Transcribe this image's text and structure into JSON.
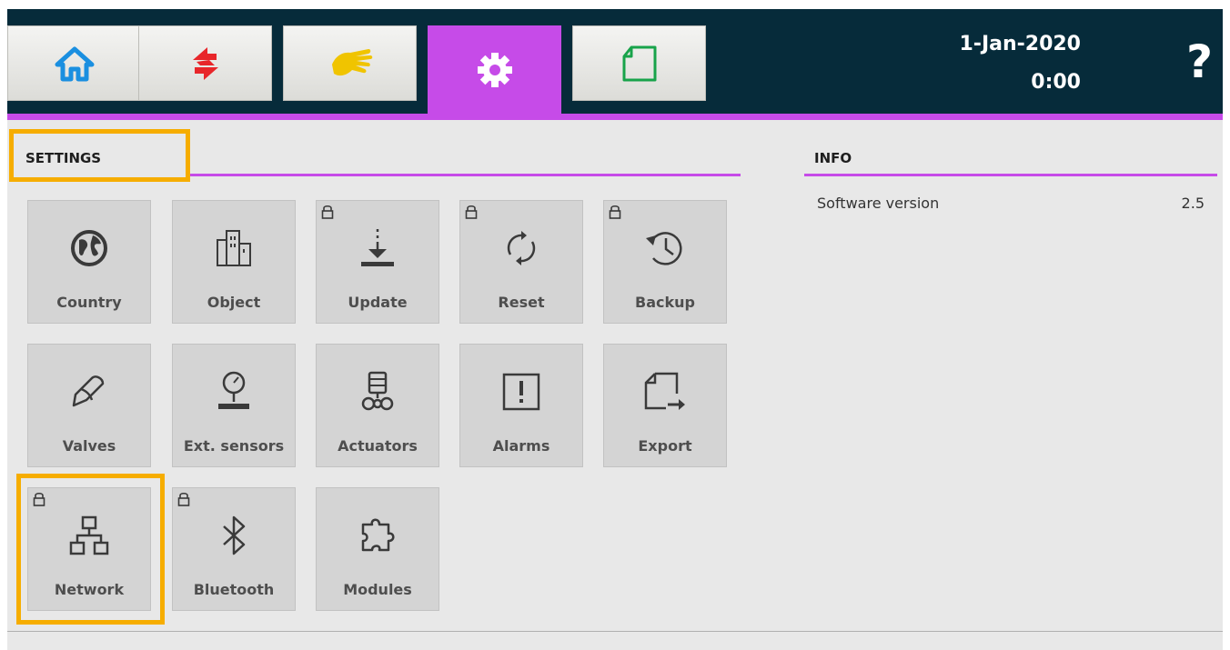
{
  "header": {
    "tabs": [
      {
        "icon": "home-icon",
        "color": "#1a8fe0"
      },
      {
        "icon": "sync-arrows-icon",
        "color": "#e8262a"
      },
      {
        "icon": "hand-icon",
        "color": "#f0c400"
      },
      {
        "icon": "gear-icon",
        "color": "#ffffff",
        "active": true
      },
      {
        "icon": "document-icon",
        "color": "#18a34a"
      }
    ],
    "date": "1-Jan-2020",
    "time": "0:00",
    "help_label": "?"
  },
  "settings": {
    "title": "SETTINGS",
    "tiles": [
      {
        "label": "Country",
        "icon": "globe-icon",
        "locked": false
      },
      {
        "label": "Object",
        "icon": "buildings-icon",
        "locked": false
      },
      {
        "label": "Update",
        "icon": "download-icon",
        "locked": true
      },
      {
        "label": "Reset",
        "icon": "refresh-icon",
        "locked": true
      },
      {
        "label": "Backup",
        "icon": "history-icon",
        "locked": true
      },
      {
        "label": "Valves",
        "icon": "valve-icon",
        "locked": false
      },
      {
        "label": "Ext. sensors",
        "icon": "gauge-icon",
        "locked": false
      },
      {
        "label": "Actuators",
        "icon": "actuator-icon",
        "locked": false
      },
      {
        "label": "Alarms",
        "icon": "alarm-icon",
        "locked": false
      },
      {
        "label": "Export",
        "icon": "export-icon",
        "locked": false
      },
      {
        "label": "Network",
        "icon": "network-icon",
        "locked": true
      },
      {
        "label": "Bluetooth",
        "icon": "bluetooth-icon",
        "locked": true
      },
      {
        "label": "Modules",
        "icon": "puzzle-icon",
        "locked": false
      }
    ]
  },
  "info": {
    "title": "INFO",
    "rows": [
      {
        "label": "Software version",
        "value": "2.5"
      }
    ]
  },
  "colors": {
    "accent": "#c64be8",
    "header_bg": "#062b3a",
    "highlight": "#f6ad00"
  }
}
